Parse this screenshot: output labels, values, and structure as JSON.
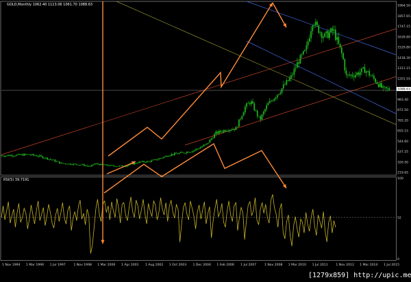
{
  "window": {
    "price_title": "GOLD,Monthly  1062.40 1113.06 1061.70 1088.63",
    "rsi_title": "RSI(5) 39.7191",
    "watermark": "[1279x859] http://upic.me/"
  },
  "colors": {
    "background": "#000000",
    "candles": "#1db31d",
    "rsi_line": "#c8b428",
    "annotation_arrows": "#ff8c3a",
    "blue_channel": "#4169e1",
    "red_channel": "#c8442a",
    "olive_channel": "#8a8a2a",
    "level_line": "#9a9a9a",
    "rsi_level": "#8c8c8c"
  },
  "chart_data": [
    {
      "type": "candlestick",
      "title": "GOLD,Monthly  1062.40 1113.06 1061.70 1088.63",
      "symbol": "GOLD",
      "timeframe": "Monthly",
      "ohlc_last": {
        "open": 1062.4,
        "high": 1113.06,
        "low": 1061.7,
        "close": 1088.63
      },
      "y_scale": "linear",
      "ylim": [
        200,
        2000
      ],
      "price_tick_labels": [
        "1964.50",
        "1857.65",
        "1747.15",
        "1639.80",
        "1529.80",
        "1418.30",
        "1311.15",
        "1201.55",
        "1088.63",
        "983.40",
        "872.50",
        "765.20",
        "655.15",
        "544.60",
        "437.25",
        "326.50",
        "219.65"
      ],
      "current_price_line": 1088.63,
      "x_tick_labels": [
        "1 Nov 1994",
        "1 Mar 1996",
        "1 Jul 1997",
        "1 Nov 1998",
        "1 Mar 2000",
        "1 Apr 2001",
        "1 Aug 2002",
        "1 Oct 2003",
        "1 Dec 2004",
        "1 Feb 2006",
        "1 Jul 2007",
        "1 Nov 2008",
        "1 Mar 2010",
        "1 Jul 2011",
        "1 Nov 2012",
        "1 Mar 2014",
        "1 Jul 2015"
      ],
      "x_start": 1994.75,
      "x_end": 2015.9,
      "close_path": [
        [
          1994.75,
          380
        ],
        [
          1995.5,
          385
        ],
        [
          1996.2,
          392
        ],
        [
          1996.8,
          375
        ],
        [
          1997.5,
          335
        ],
        [
          1998.0,
          298
        ],
        [
          1998.6,
          290
        ],
        [
          1999.2,
          280
        ],
        [
          1999.6,
          262
        ],
        [
          1999.8,
          295
        ],
        [
          2000.3,
          280
        ],
        [
          2001.0,
          268
        ],
        [
          2001.5,
          270
        ],
        [
          2002.2,
          310
        ],
        [
          2002.8,
          318
        ],
        [
          2003.3,
          345
        ],
        [
          2003.9,
          390
        ],
        [
          2004.6,
          410
        ],
        [
          2005.2,
          435
        ],
        [
          2005.9,
          500
        ],
        [
          2006.4,
          620
        ],
        [
          2007.0,
          660
        ],
        [
          2007.5,
          670
        ],
        [
          2008.0,
          900
        ],
        [
          2008.3,
          960
        ],
        [
          2008.8,
          760
        ],
        [
          2009.2,
          920
        ],
        [
          2009.8,
          1050
        ],
        [
          2010.5,
          1220
        ],
        [
          2010.9,
          1390
        ],
        [
          2011.3,
          1500
        ],
        [
          2011.7,
          1850
        ],
        [
          2011.8,
          1780
        ],
        [
          2012.3,
          1650
        ],
        [
          2012.8,
          1720
        ],
        [
          2013.3,
          1440
        ],
        [
          2013.5,
          1230
        ],
        [
          2014.0,
          1250
        ],
        [
          2014.5,
          1300
        ],
        [
          2015.0,
          1200
        ],
        [
          2015.5,
          1090
        ],
        [
          2015.9,
          1088.63
        ]
      ]
    },
    {
      "type": "line",
      "title": "RSI(5) 39.7191",
      "indicator": "RSI",
      "period": 5,
      "last_value": 39.7191,
      "ylim": [
        0,
        100
      ],
      "y_tick_labels": [
        "100",
        "52",
        "0"
      ],
      "levels": [
        52
      ],
      "values": [
        52,
        66,
        49,
        60,
        71,
        45,
        54,
        62,
        40,
        58,
        69,
        46,
        52,
        63,
        57,
        38,
        50,
        67,
        55,
        44,
        60,
        72,
        48,
        56,
        64,
        42,
        53,
        68,
        58,
        45,
        39,
        55,
        63,
        47,
        58,
        70,
        51,
        44,
        61,
        66,
        36,
        52,
        59,
        48,
        65,
        73,
        50,
        57,
        43,
        62,
        54,
        8,
        18,
        40,
        63,
        74,
        55,
        47,
        68,
        72,
        58,
        66,
        49,
        71,
        60,
        52,
        75,
        63,
        45,
        68,
        70,
        55,
        48,
        64,
        77,
        59,
        52,
        73,
        66,
        50,
        61,
        74,
        57,
        44,
        69,
        60,
        53,
        72,
        67,
        49,
        58,
        76,
        62,
        55,
        70,
        47,
        66,
        73,
        58,
        51,
        68,
        61,
        22,
        45,
        64,
        70,
        56,
        49,
        72,
        63,
        54,
        38,
        59,
        67,
        50,
        61,
        71,
        44,
        57,
        65,
        27,
        48,
        62,
        74,
        53,
        58,
        69,
        46,
        40,
        60,
        72,
        55,
        47,
        66,
        70,
        36,
        52,
        64,
        58,
        25,
        48,
        67,
        71,
        54,
        60,
        76,
        49,
        43,
        62,
        70,
        57,
        68,
        52,
        45,
        73,
        80,
        64,
        56,
        40,
        61,
        69,
        33,
        26,
        47,
        55,
        30,
        17,
        42,
        53,
        38,
        28,
        50,
        46,
        33,
        58,
        44,
        35,
        52,
        62,
        41,
        30,
        55,
        47,
        39,
        59,
        35,
        22,
        46,
        54,
        33,
        48,
        40
      ]
    }
  ]
}
